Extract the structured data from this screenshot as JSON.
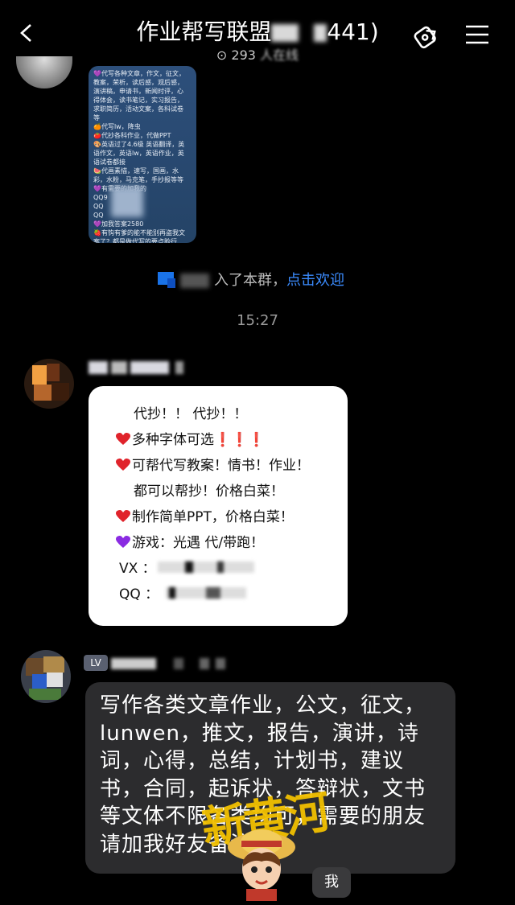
{
  "header": {
    "title_prefix": "作业帮写联盟",
    "title_suffix": "441)",
    "member_count": "293",
    "member_suffix": "人在线"
  },
  "image_message": {
    "lines": [
      "💜代写各种文章，作文，征文，",
      "教案，荣析，读后感，观后感，",
      "演讲稿，申请书，新闻时评，心",
      "得体会，读书笔记，实习报告，",
      "求职简历，活动文案，各科试卷",
      "等",
      "🍊代写lw，降虫",
      "🍅代抄各科作业，代做PPT",
      "🎨英语过了4.6级 英语翻译，英",
      "语作文，英语lw，英语作业，英",
      "语试卷都接",
      "🍉代画素描，速写，国画，水",
      "彩，水粉，马克笔，手抄报等等",
      "💜有需要的加我的",
      "QQ9",
      "QQ",
      "QQ",
      "💜加我答案2580",
      "🍓有钩有爹的能不能别再盗我文",
      "案了？都是做代写的要点脸行",
      "吗？"
    ]
  },
  "join_notice": {
    "text": "入了本群，",
    "link": "点击欢迎"
  },
  "timestamp": "15:27",
  "message1": {
    "line1": "代抄！！ 代抄！！",
    "line2": "多种字体可选",
    "line2_marks": "❗❗❗",
    "line3": "可帮代写教案！情书！作业！",
    "line4": "都可以帮抄！价格白菜！",
    "line5": "制作简单PPT，价格白菜！",
    "line6": "游戏：光遇  代/带跑！",
    "vx_label": "VX ：",
    "qq_label": "QQ ："
  },
  "message2": {
    "tag": "LV",
    "text": "写作各类文章作业，公文，征文，lunwen，推文，报告，演讲，诗词，心得，总结，计划书，建议书，合同，起诉状，答辩状，文书等文体不限各类均可，需要的朋友请加我好友备注"
  },
  "me_label": "我",
  "watermark_text": "新黄河",
  "colors": {
    "background": "#000000",
    "link": "#3b8cff",
    "heart_red": "#e0232b",
    "heart_purple": "#8a2be2",
    "watermark": "#f2c000"
  }
}
